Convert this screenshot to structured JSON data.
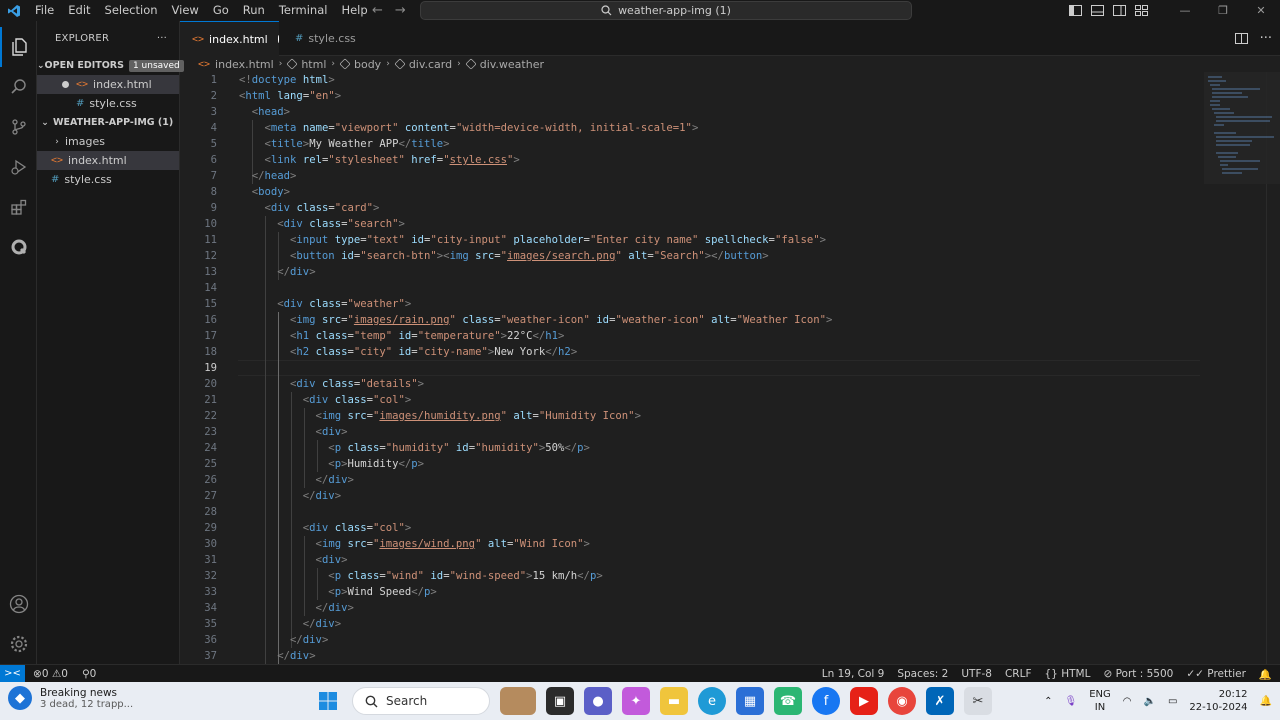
{
  "titlebar": {
    "menu": [
      "File",
      "Edit",
      "Selection",
      "View",
      "Go",
      "Run",
      "Terminal",
      "Help"
    ],
    "search_text": "weather-app-img (1)"
  },
  "sidebar": {
    "title": "EXPLORER",
    "open_editors_label": "OPEN EDITORS",
    "unsaved_badge": "1 unsaved",
    "open_editors": [
      "index.html",
      "style.css"
    ],
    "folder_label": "WEATHER-APP-IMG (1)",
    "tree": [
      "images",
      "index.html",
      "style.css"
    ]
  },
  "tabs": [
    {
      "label": "index.html",
      "icon": "html-file-icon",
      "modified": true
    },
    {
      "label": "style.css",
      "icon": "css-file-icon",
      "modified": false
    }
  ],
  "breadcrumb": [
    "index.html",
    "html",
    "body",
    "div.card",
    "div.weather"
  ],
  "editor": {
    "line_numbers": [
      "1",
      "2",
      "3",
      "4",
      "5",
      "6",
      "7",
      "8",
      "9",
      "10",
      "11",
      "12",
      "13",
      "14",
      "15",
      "16",
      "17",
      "18",
      "19",
      "20",
      "21",
      "22",
      "23",
      "24",
      "25",
      "26",
      "27",
      "28",
      "29",
      "30",
      "31",
      "32",
      "33",
      "34",
      "35",
      "36",
      "37"
    ],
    "current_line": "19"
  },
  "statusbar": {
    "errors": "0",
    "warnings": "0",
    "ports": "0",
    "position": "Ln 19, Col 9",
    "spaces": "Spaces: 2",
    "encoding": "UTF-8",
    "eol": "CRLF",
    "language": "HTML",
    "port": "Port : 5500",
    "formatter": "Prettier"
  },
  "taskbar": {
    "news_title": "Breaking news",
    "news_sub": "3 dead, 12 trapp...",
    "search_label": "Search",
    "lang_top": "ENG",
    "lang_bottom": "IN",
    "time": "20:12",
    "date": "22-10-2024"
  },
  "colors": {
    "accent": "#0078d4",
    "editor_bg": "#1f1f1f",
    "tag": "#569cd6",
    "attr": "#9cdcfe",
    "string": "#ce9178"
  }
}
